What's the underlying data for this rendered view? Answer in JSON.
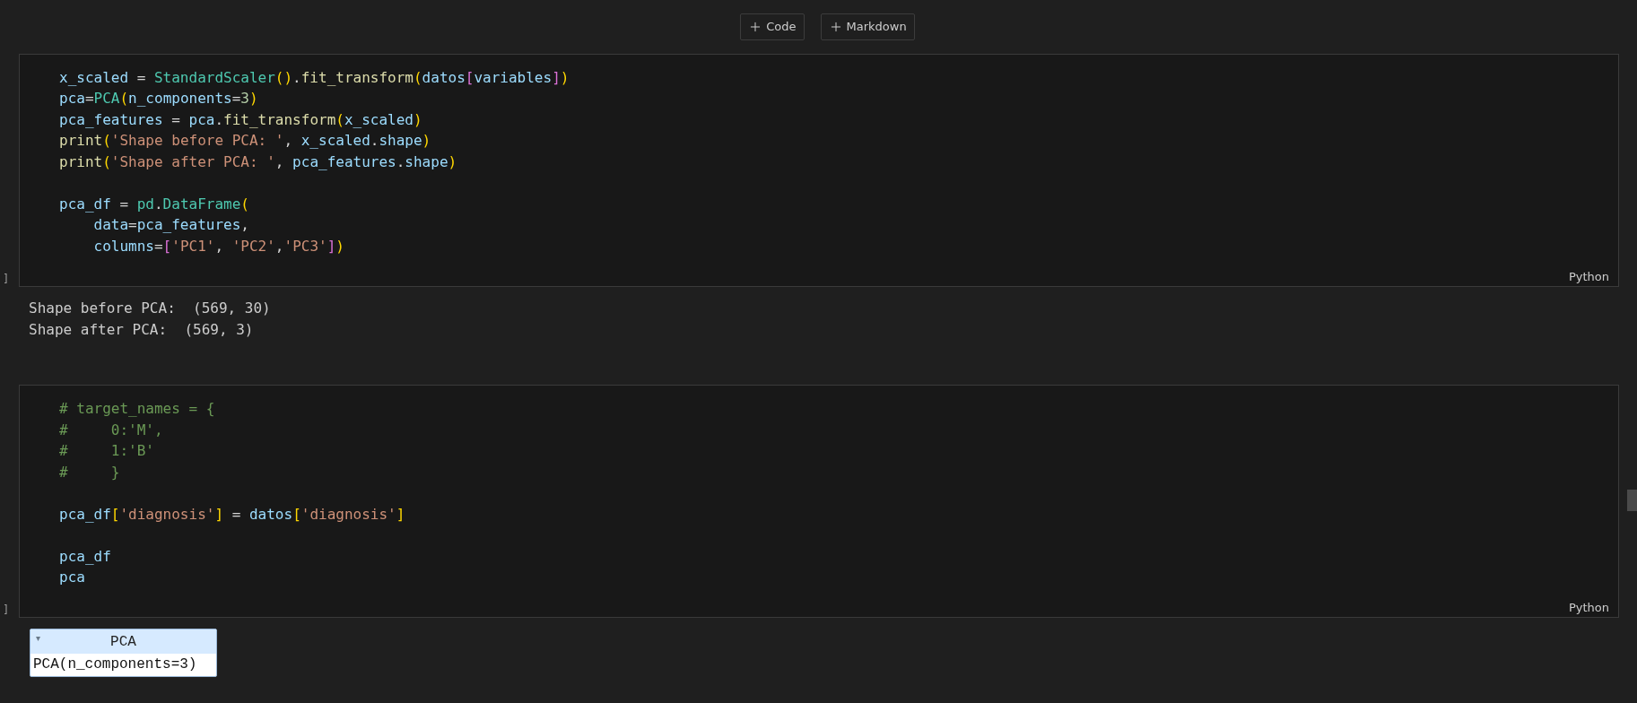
{
  "toolbar": {
    "buttons": [
      {
        "label": "Code"
      },
      {
        "label": "Markdown"
      }
    ]
  },
  "cells": [
    {
      "execution_count": "]",
      "language": "Python",
      "blocks": [
        [
          [
            {
              "t": "x_scaled",
              "color": "#9cdcfe"
            },
            {
              "t": " = ",
              "color": "#d4d4d4"
            },
            {
              "t": "StandardScaler",
              "color": "#4ec9b0"
            },
            {
              "t": "()",
              "color": "#ffd700"
            },
            {
              "t": "."
            },
            {
              "t": "fit_transform",
              "color": "#dcdcaa"
            },
            {
              "t": "(",
              "color": "#ffd700"
            },
            {
              "t": "datos",
              "color": "#9cdcfe"
            },
            {
              "t": "[",
              "color": "#da70d6"
            },
            {
              "t": "variables",
              "color": "#9cdcfe"
            },
            {
              "t": "]",
              "color": "#da70d6"
            },
            {
              "t": ")",
              "color": "#ffd700"
            }
          ],
          [
            {
              "t": "pca",
              "color": "#9cdcfe"
            },
            {
              "t": "=",
              "color": "#d4d4d4"
            },
            {
              "t": "PCA",
              "color": "#4ec9b0"
            },
            {
              "t": "(",
              "color": "#ffd700"
            },
            {
              "t": "n_components",
              "color": "#9cdcfe"
            },
            {
              "t": "=",
              "color": "#d4d4d4"
            },
            {
              "t": "3",
              "color": "#b5cea8"
            },
            {
              "t": ")",
              "color": "#ffd700"
            }
          ],
          [
            {
              "t": "pca_features",
              "color": "#9cdcfe"
            },
            {
              "t": " = ",
              "color": "#d4d4d4"
            },
            {
              "t": "pca",
              "color": "#9cdcfe"
            },
            {
              "t": "."
            },
            {
              "t": "fit_transform",
              "color": "#dcdcaa"
            },
            {
              "t": "(",
              "color": "#ffd700"
            },
            {
              "t": "x_scaled",
              "color": "#9cdcfe"
            },
            {
              "t": ")",
              "color": "#ffd700"
            }
          ],
          [
            {
              "t": "print",
              "color": "#dcdcaa"
            },
            {
              "t": "(",
              "color": "#ffd700"
            },
            {
              "t": "'Shape before PCA: '",
              "color": "#ce9178"
            },
            {
              "t": ", ",
              "color": "#d4d4d4"
            },
            {
              "t": "x_scaled",
              "color": "#9cdcfe"
            },
            {
              "t": "."
            },
            {
              "t": "shape",
              "color": "#9cdcfe"
            },
            {
              "t": ")",
              "color": "#ffd700"
            }
          ],
          [
            {
              "t": "print",
              "color": "#dcdcaa"
            },
            {
              "t": "(",
              "color": "#ffd700"
            },
            {
              "t": "'Shape after PCA: '",
              "color": "#ce9178"
            },
            {
              "t": ", ",
              "color": "#d4d4d4"
            },
            {
              "t": "pca_features",
              "color": "#9cdcfe"
            },
            {
              "t": "."
            },
            {
              "t": "shape",
              "color": "#9cdcfe"
            },
            {
              "t": ")",
              "color": "#ffd700"
            }
          ]
        ],
        [
          [
            {
              "t": "pca_df",
              "color": "#9cdcfe"
            },
            {
              "t": " = ",
              "color": "#d4d4d4"
            },
            {
              "t": "pd",
              "color": "#4ec9b0"
            },
            {
              "t": "."
            },
            {
              "t": "DataFrame",
              "color": "#4ec9b0"
            },
            {
              "t": "(",
              "color": "#ffd700"
            }
          ],
          [
            {
              "t": "    data",
              "color": "#9cdcfe"
            },
            {
              "t": "=",
              "color": "#d4d4d4"
            },
            {
              "t": "pca_features",
              "color": "#9cdcfe"
            },
            {
              "t": ",",
              "color": "#d4d4d4"
            }
          ],
          [
            {
              "t": "    columns",
              "color": "#9cdcfe"
            },
            {
              "t": "=",
              "color": "#d4d4d4"
            },
            {
              "t": "[",
              "color": "#da70d6"
            },
            {
              "t": "'PC1'",
              "color": "#ce9178"
            },
            {
              "t": ", ",
              "color": "#d4d4d4"
            },
            {
              "t": "'PC2'",
              "color": "#ce9178"
            },
            {
              "t": ",",
              "color": "#d4d4d4"
            },
            {
              "t": "'PC3'",
              "color": "#ce9178"
            },
            {
              "t": "]",
              "color": "#da70d6"
            },
            {
              "t": ")",
              "color": "#ffd700"
            }
          ]
        ]
      ],
      "output": {
        "kind": "text",
        "lines": [
          "Shape before PCA:  (569, 30)",
          "Shape after PCA:  (569, 3)"
        ]
      }
    },
    {
      "execution_count": "]",
      "language": "Python",
      "blocks": [
        [
          [
            {
              "t": "# target_names = {",
              "color": "#6a9955"
            }
          ],
          [
            {
              "t": "#     0:'M',",
              "color": "#6a9955"
            }
          ],
          [
            {
              "t": "#     1:'B'",
              "color": "#6a9955"
            }
          ],
          [
            {
              "t": "#     }",
              "color": "#6a9955"
            }
          ]
        ],
        [
          [
            {
              "t": "pca_df",
              "color": "#9cdcfe"
            },
            {
              "t": "[",
              "color": "#ffd700"
            },
            {
              "t": "'diagnosis'",
              "color": "#ce9178"
            },
            {
              "t": "]",
              "color": "#ffd700"
            },
            {
              "t": " = ",
              "color": "#d4d4d4"
            },
            {
              "t": "datos",
              "color": "#9cdcfe"
            },
            {
              "t": "[",
              "color": "#ffd700"
            },
            {
              "t": "'diagnosis'",
              "color": "#ce9178"
            },
            {
              "t": "]",
              "color": "#ffd700"
            }
          ]
        ],
        [
          [
            {
              "t": "pca_df",
              "color": "#9cdcfe"
            }
          ],
          [
            {
              "t": "pca",
              "color": "#9cdcfe"
            }
          ]
        ]
      ],
      "output": {
        "kind": "estimator",
        "caret": "▾",
        "title": "PCA",
        "body": "PCA(n_components=3)"
      }
    }
  ]
}
